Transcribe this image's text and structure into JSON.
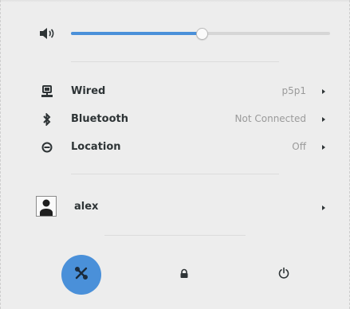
{
  "volume": {
    "icon": "speaker-icon",
    "level_fraction": 0.5
  },
  "menu": [
    {
      "label": "Wired",
      "value": "p5p1",
      "icon": "network-wired-icon"
    },
    {
      "label": "Bluetooth",
      "value": "Not Connected",
      "icon": "bluetooth-icon"
    },
    {
      "label": "Location",
      "value": "Off",
      "icon": "location-icon"
    }
  ],
  "user": {
    "name": "alex",
    "icon": "avatar-icon"
  },
  "actions": [
    {
      "name": "settings",
      "icon": "settings-icon"
    },
    {
      "name": "lock",
      "icon": "lock-icon"
    },
    {
      "name": "power",
      "icon": "power-icon"
    }
  ],
  "colors": {
    "accent": "#4a90d9",
    "background": "#ededed",
    "text": "#2e3436",
    "muted": "#9a9a9a"
  }
}
